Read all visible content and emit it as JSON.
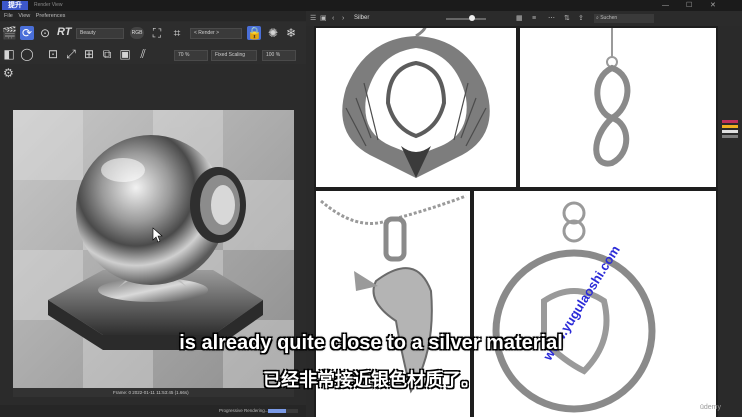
{
  "app": {
    "logo_text": "提升",
    "window_title": "Render View",
    "menu": [
      "File",
      "View",
      "Preferences"
    ]
  },
  "toolbar": {
    "rt_label": "RT",
    "render_setting": "Beauty",
    "render_mode": "< Render >",
    "zoom_value": "70 %",
    "scaling": "Fixed Scaling",
    "scale_percent": "100 %"
  },
  "viewport": {
    "frame_info": "Frame: 0  2022-01-11  11:53:45  (1.66s)",
    "progress_label": "Progressive Rendering...",
    "progress": 0.6
  },
  "browser": {
    "folder": "Silber",
    "search_placeholder": "Suchen",
    "window_controls": [
      "—",
      "☐",
      "✕"
    ]
  },
  "sidepanel_colors": [
    "#c0305a",
    "#f0b020",
    "#e0e0e0",
    "#7d7d7d"
  ],
  "subtitle": {
    "english": "is already quite close to a silver material",
    "chinese": "已经非常接近银色材质了。"
  },
  "watermark": "www.yugulaoshi.com",
  "udemy_label": "ūdemy"
}
